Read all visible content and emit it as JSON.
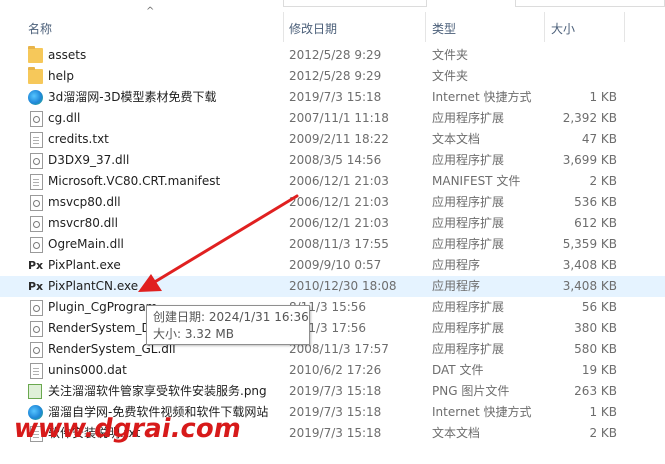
{
  "columns": {
    "name": "名称",
    "date": "修改日期",
    "type": "类型",
    "size": "大小"
  },
  "rows": [
    {
      "name": "assets",
      "date": "2012/5/28 9:29",
      "type": "文件夹",
      "size": "",
      "icon": "folder-icon"
    },
    {
      "name": "help",
      "date": "2012/5/28 9:29",
      "type": "文件夹",
      "size": "",
      "icon": "folder-icon"
    },
    {
      "name": "3d溜溜网-3D模型素材免费下载",
      "date": "2019/7/3 15:18",
      "type": "Internet 快捷方式",
      "size": "1 KB",
      "icon": "browser-shortcut-icon"
    },
    {
      "name": "cg.dll",
      "date": "2007/11/1 11:18",
      "type": "应用程序扩展",
      "size": "2,392 KB",
      "icon": "dll-icon"
    },
    {
      "name": "credits.txt",
      "date": "2009/2/11 18:22",
      "type": "文本文档",
      "size": "47 KB",
      "icon": "text-file-icon"
    },
    {
      "name": "D3DX9_37.dll",
      "date": "2008/3/5 14:56",
      "type": "应用程序扩展",
      "size": "3,699 KB",
      "icon": "dll-icon"
    },
    {
      "name": "Microsoft.VC80.CRT.manifest",
      "date": "2006/12/1 21:03",
      "type": "MANIFEST 文件",
      "size": "2 KB",
      "icon": "file-icon"
    },
    {
      "name": "msvcp80.dll",
      "date": "2006/12/1 21:03",
      "type": "应用程序扩展",
      "size": "536 KB",
      "icon": "dll-icon"
    },
    {
      "name": "msvcr80.dll",
      "date": "2006/12/1 21:03",
      "type": "应用程序扩展",
      "size": "612 KB",
      "icon": "dll-icon"
    },
    {
      "name": "OgreMain.dll",
      "date": "2008/11/3 17:55",
      "type": "应用程序扩展",
      "size": "5,359 KB",
      "icon": "dll-icon"
    },
    {
      "name": "PixPlant.exe",
      "date": "2009/9/10 0:57",
      "type": "应用程序",
      "size": "3,408 KB",
      "icon": "pixplant-app-icon"
    },
    {
      "name": "PixPlantCN.exe",
      "date": "2010/12/30 18:08",
      "type": "应用程序",
      "size": "3,408 KB",
      "icon": "pixplant-app-icon"
    },
    {
      "name": "Plugin_CgProgram",
      "date": "8/11/3 15:56",
      "type": "应用程序扩展",
      "size": "56 KB",
      "icon": "dll-icon"
    },
    {
      "name": "RenderSystem_Di",
      "date": "8/11/3 17:56",
      "type": "应用程序扩展",
      "size": "380 KB",
      "icon": "dll-icon"
    },
    {
      "name": "RenderSystem_GL.dll",
      "date": "2008/11/3 17:57",
      "type": "应用程序扩展",
      "size": "580 KB",
      "icon": "dll-icon"
    },
    {
      "name": "unins000.dat",
      "date": "2010/6/2 17:26",
      "type": "DAT 文件",
      "size": "19 KB",
      "icon": "file-icon"
    },
    {
      "name": "关注溜溜软件管家享受软件安装服务.png",
      "date": "2019/7/3 15:18",
      "type": "PNG 图片文件",
      "size": "263 KB",
      "icon": "png-image-icon"
    },
    {
      "name": "溜溜自学网-免费软件视频和软件下载网站",
      "date": "2019/7/3 15:18",
      "type": "Internet 快捷方式",
      "size": "1 KB",
      "icon": "browser-shortcut-icon"
    },
    {
      "name": "软件安装说明.txt",
      "date": "2019/7/3 15:18",
      "type": "文本文档",
      "size": "2 KB",
      "icon": "text-file-icon"
    }
  ],
  "selected_row": 11,
  "tooltip": {
    "created": "创建日期: 2024/1/31 16:36",
    "size": "大小: 3.32 MB"
  },
  "watermark": "www.dgrai.com",
  "colors": {
    "selection": "#e5f3ff",
    "arrow": "#e02020",
    "watermark": "#d71a1a",
    "header_text": "#4c607a"
  }
}
